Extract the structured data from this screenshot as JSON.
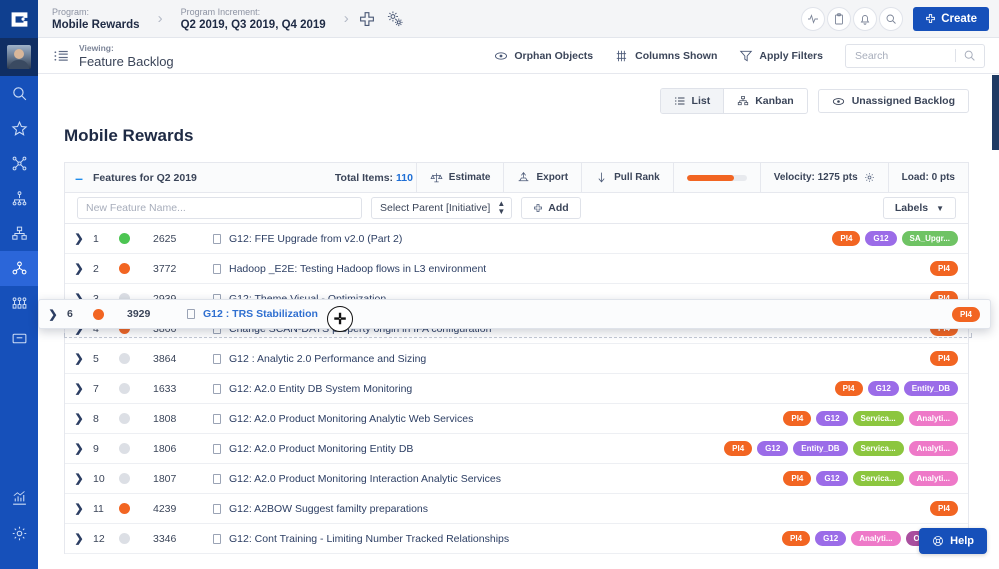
{
  "rail": {
    "logo_icon": "app-logo-icon",
    "avatar_alt": "user-avatar",
    "items": [
      {
        "icon": "search-icon",
        "name": "search",
        "active": false
      },
      {
        "icon": "star-icon",
        "name": "favorites",
        "active": false
      },
      {
        "icon": "network-icon",
        "name": "roadmap",
        "active": false
      },
      {
        "icon": "hierarchy-icon",
        "name": "portfolio",
        "active": false
      },
      {
        "icon": "org-chart-icon",
        "name": "programs",
        "active": false
      },
      {
        "icon": "teams-icon",
        "name": "teams",
        "active": true
      },
      {
        "icon": "people-group-icon",
        "name": "people",
        "active": false
      },
      {
        "icon": "inbox-icon",
        "name": "inbox",
        "active": false
      },
      {
        "icon": "chart-icon",
        "name": "analytics",
        "active": false
      },
      {
        "icon": "gear-icon",
        "name": "settings",
        "active": false
      }
    ]
  },
  "topbar": {
    "program_label": "Program:",
    "program_value": "Mobile Rewards",
    "increment_label": "Program Increment:",
    "increment_value": "Q2 2019, Q3 2019, Q4 2019",
    "add_icon": "plus-icon",
    "settings_icon": "gears-icon",
    "actions": [
      {
        "icon": "activity-icon",
        "name": "activity"
      },
      {
        "icon": "clipboard-icon",
        "name": "clipboard"
      },
      {
        "icon": "bell-icon",
        "name": "notifications"
      },
      {
        "icon": "search-icon",
        "name": "global-search"
      }
    ],
    "create_label": "Create"
  },
  "subbar": {
    "viewing_label": "Viewing:",
    "viewing_value": "Feature Backlog",
    "list_icon": "list-view-icon",
    "actions": [
      {
        "icon": "eye-icon",
        "label": "Orphan Objects",
        "name": "orphan-objects"
      },
      {
        "icon": "columns-icon",
        "label": "Columns Shown",
        "name": "columns-shown"
      },
      {
        "icon": "funnel-icon",
        "label": "Apply Filters",
        "name": "apply-filters"
      }
    ],
    "search_placeholder": "Search",
    "search_value": ""
  },
  "view_tabs": {
    "segmented": [
      {
        "label": "List",
        "icon": "list-icon",
        "active": true
      },
      {
        "label": "Kanban",
        "icon": "kanban-icon",
        "active": false
      }
    ],
    "unassigned": {
      "label": "Unassigned Backlog",
      "icon": "eye-icon"
    }
  },
  "page_title": "Mobile Rewards",
  "panel": {
    "collapse_glyph": "–",
    "features_for": "Features for  Q2 2019",
    "total_items_label": "Total Items:",
    "total_items_value": "110",
    "head_actions": [
      {
        "label": "Estimate",
        "icon": "scale-icon",
        "name": "estimate"
      },
      {
        "label": "Export",
        "icon": "export-icon",
        "name": "export"
      },
      {
        "label": "Pull Rank",
        "icon": "down-arrow-icon",
        "name": "pull-rank"
      }
    ],
    "velocity_progress_pct": 78,
    "velocity_bar_color": "#f26522",
    "velocity_label": "Velocity: 1275 pts",
    "velocity_gear_icon": "gear-icon",
    "load_label": "Load: 0 pts",
    "new_feature_placeholder": "New Feature Name...",
    "new_feature_value": "",
    "select_parent_label": "Select Parent [Initiative]",
    "add_label": "Add",
    "add_icon": "plus-icon",
    "labels_label": "Labels"
  },
  "tag_colors": {
    "PI4": "#f26522",
    "G12": "#9b6ce8",
    "SA_Upgr...": "#6fc364",
    "Entity_DB": "#9b6ce8",
    "Servica...": "#8cc63f",
    "Analyti...": "#ee79c8",
    "On_Trai...": "#a94f9e"
  },
  "status_colors": {
    "green": "#4cc552",
    "orange": "#f26522",
    "grey": "#dcdfe5"
  },
  "rows": [
    {
      "num": "1",
      "status": "green",
      "id": "2625",
      "title": "G12: FFE Upgrade from v2.0 (Part 2)",
      "tags": [
        "PI4",
        "G12",
        "SA_Upgr..."
      ]
    },
    {
      "num": "2",
      "status": "orange",
      "id": "3772",
      "title": "Hadoop _E2E: Testing Hadoop flows in L3 environment",
      "tags": [
        "PI4"
      ]
    },
    {
      "num": "3",
      "status": "grey",
      "id": "2939",
      "title": "G12: Theme Visual - Optimization",
      "tags": [
        "PI4"
      ]
    },
    {
      "num": "4",
      "status": "orange",
      "id": "3866",
      "title": "Change SCAN-DAYS property origin in IFA configuration",
      "tags": [
        "PI4"
      ]
    },
    {
      "num": "5",
      "status": "grey",
      "id": "3864",
      "title": "G12 : Analytic 2.0 Performance and Sizing",
      "tags": [
        "PI4"
      ]
    },
    {
      "num": "7",
      "status": "grey",
      "id": "1633",
      "title": "G12: A2.0 Entity DB System Monitoring",
      "tags": [
        "PI4",
        "G12",
        "Entity_DB"
      ]
    },
    {
      "num": "8",
      "status": "grey",
      "id": "1808",
      "title": "G12: A2.0 Product Monitoring Analytic Web Services",
      "tags": [
        "PI4",
        "G12",
        "Servica...",
        "Analyti..."
      ]
    },
    {
      "num": "9",
      "status": "grey",
      "id": "1806",
      "title": "G12: A2.0 Product Monitoring Entity DB",
      "tags": [
        "PI4",
        "G12",
        "Entity_DB",
        "Servica...",
        "Analyti..."
      ]
    },
    {
      "num": "10",
      "status": "grey",
      "id": "1807",
      "title": "G12: A2.0 Product Monitoring Interaction Analytic Services",
      "tags": [
        "PI4",
        "G12",
        "Servica...",
        "Analyti..."
      ]
    },
    {
      "num": "11",
      "status": "orange",
      "id": "4239",
      "title": "G12: A2BOW Suggest familty preparations",
      "tags": [
        "PI4"
      ]
    },
    {
      "num": "12",
      "status": "grey",
      "id": "3346",
      "title": "G12: Cont Training - Limiting Number Tracked Relationships",
      "tags": [
        "PI4",
        "G12",
        "Analyti...",
        "On_Trai..."
      ]
    }
  ],
  "drag_row": {
    "num": "6",
    "status": "orange",
    "id": "3929",
    "title": "G12 : TRS Stabilization",
    "tags": [
      "PI4"
    ],
    "cursor_glyph": "✛"
  },
  "help": {
    "label": "Help",
    "icon": "lifebuoy-icon"
  }
}
